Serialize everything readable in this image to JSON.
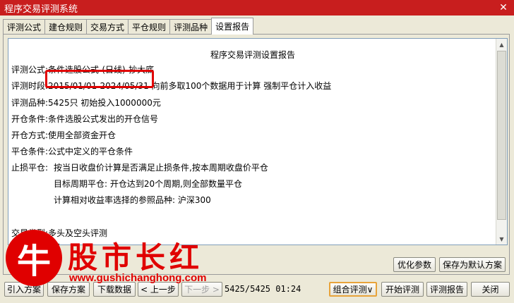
{
  "window": {
    "title": "程序交易评测系统",
    "close_glyph": "✕"
  },
  "tabs": [
    "评测公式",
    "建仓规则",
    "交易方式",
    "平仓规则",
    "评测品种",
    "设置报告"
  ],
  "report": {
    "title": "程序交易评测设置报告",
    "lines": [
      {
        "label": "评测公式:",
        "value": "条件选股公式-(日线)-抄大底"
      },
      {
        "label": "评测时段:",
        "value": "2015/01/01-2024/05/31 向前多取100个数据用于计算 强制平仓计入收益"
      },
      {
        "label": "评测品种:",
        "value": "5425只 初始投入1000000元"
      },
      {
        "label": "开仓条件:",
        "value": "条件选股公式发出的开仓信号"
      },
      {
        "label": "开仓方式:",
        "value": "使用全部资金开仓"
      },
      {
        "label": "平仓条件:",
        "value": "公式中定义的平仓条件"
      },
      {
        "label": "止损平仓:",
        "value": "按当日收盘价计算是否满足止损条件,按本周期收盘价平仓"
      },
      {
        "label": "",
        "value": "目标周期平仓: 开仓达到20个周期,则全部数量平仓"
      },
      {
        "label": "",
        "value": "计算相对收益率选择的参照品种: 沪深300"
      },
      {
        "label": "",
        "value": ""
      },
      {
        "label": "交易类型:",
        "value": "多头及空头评测"
      },
      {
        "label": "",
        "value": "位:"
      }
    ]
  },
  "panel_buttons": {
    "optimize": "优化参数",
    "save_default": "保存为默认方案"
  },
  "bottom": {
    "load_plan": "引入方案",
    "save_plan": "保存方案",
    "download": "下载数据",
    "prev": "< 上一步",
    "next": "下一步 >",
    "status": "5425/5425 01:24",
    "combo": "组合评测∨",
    "start": "开始评测",
    "report": "评测报告",
    "close": "关闭"
  },
  "watermark": {
    "logo_char": "牛",
    "text": "股市长红",
    "url": "www.gushichanghong.com"
  },
  "colors": {
    "titlebar": "#c81e1e",
    "highlight_box": "#e00000",
    "watermark": "#e00000"
  }
}
